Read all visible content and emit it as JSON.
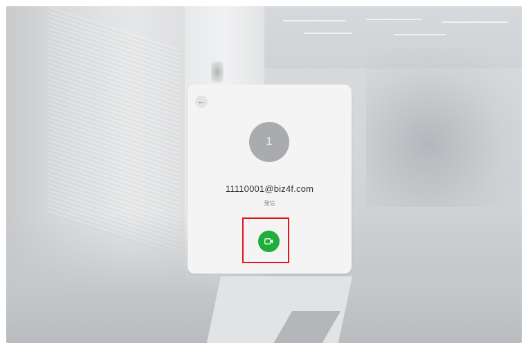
{
  "contact": {
    "avatar_initial": "1",
    "email": "11110001@biz4f.com",
    "status": "発信"
  },
  "icons": {
    "back": "back-arrow-icon",
    "call": "video-camera-icon"
  },
  "colors": {
    "call_button": "#1fae3a",
    "highlight": "#e0141c",
    "avatar": "#a9abaf"
  }
}
